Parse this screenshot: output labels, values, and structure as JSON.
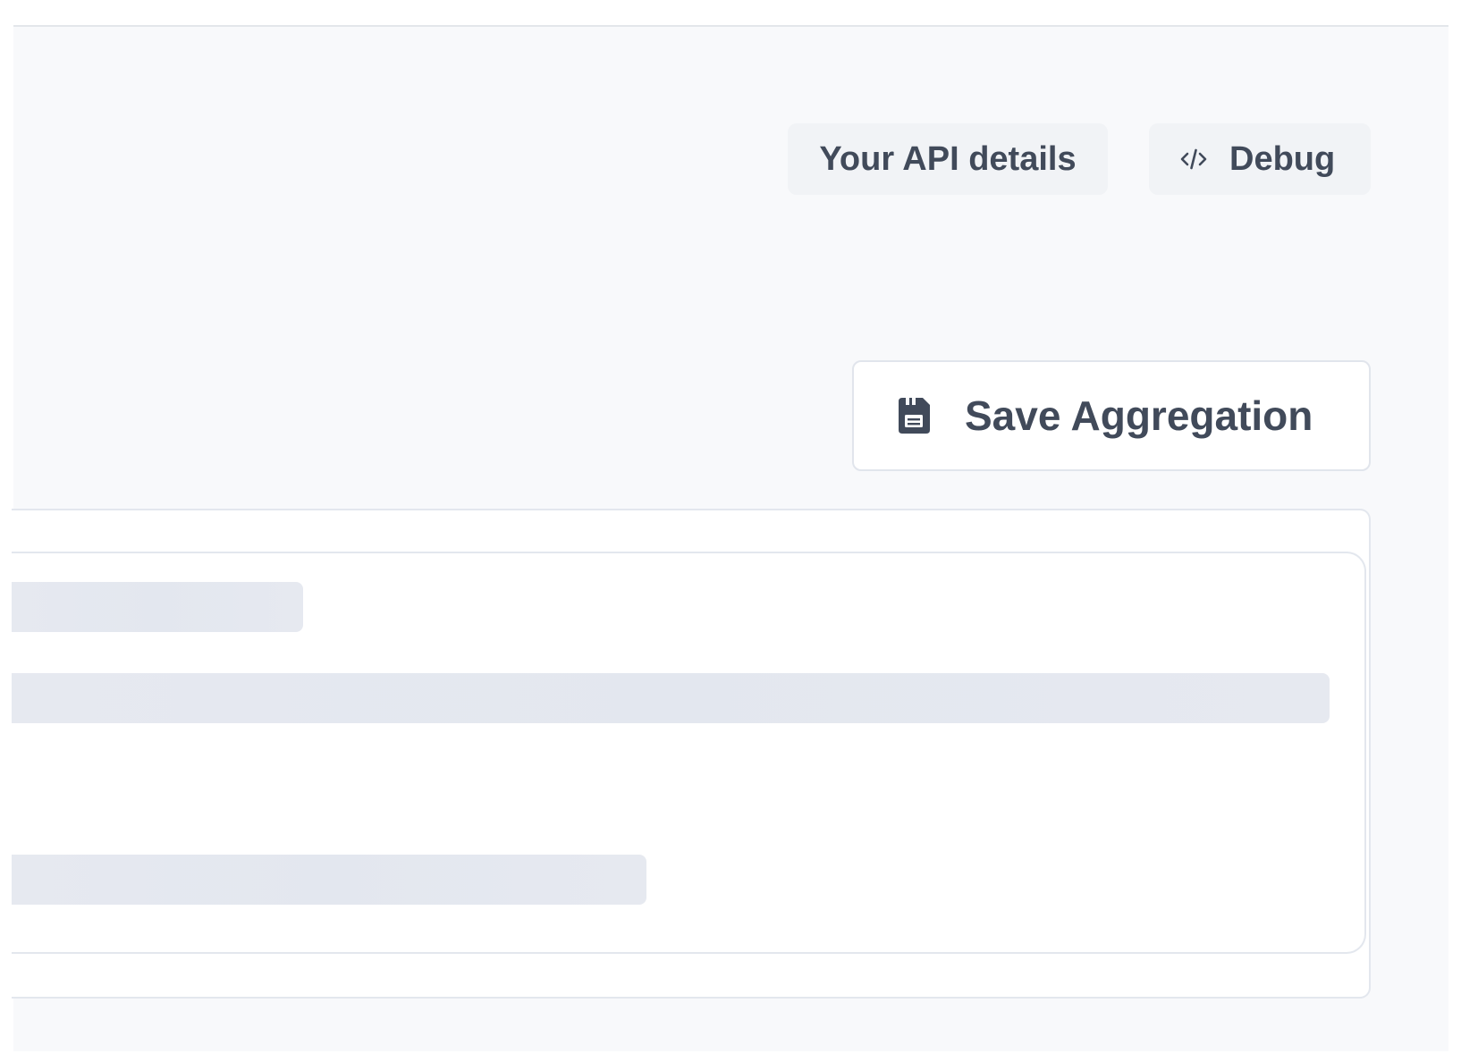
{
  "header": {
    "api_details_label": "Your API details",
    "debug_label": "Debug",
    "debug_icon": "code-icon"
  },
  "toolbar": {
    "save_label": "Save Aggregation",
    "save_icon": "floppy-disk-icon"
  },
  "colors": {
    "text": "#414a5a",
    "page_background": "#f8f9fb",
    "ghost_button": "#f1f3f6",
    "skeleton": "#e5e8ef",
    "border": "#e3e7ee"
  }
}
